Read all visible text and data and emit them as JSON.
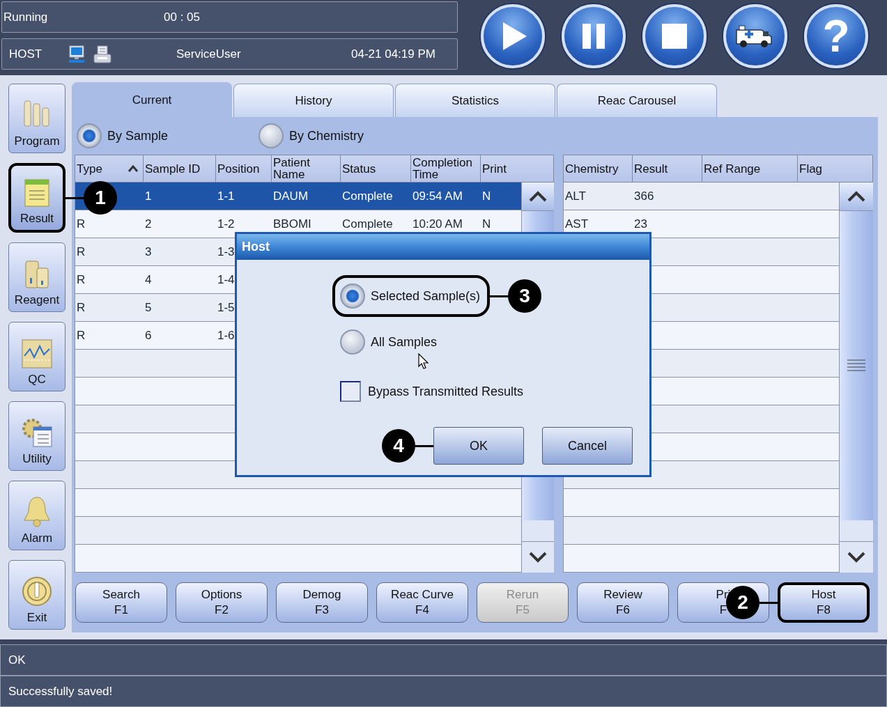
{
  "status_panel": {
    "state": "Running",
    "timer": "00 : 05",
    "mode": "HOST",
    "user": "ServiceUser",
    "datetime": "04-21 04:19 PM"
  },
  "toolbar": [
    {
      "kind": "play"
    },
    {
      "kind": "pause"
    },
    {
      "kind": "stop"
    },
    {
      "kind": "stat"
    },
    {
      "kind": "help",
      "glyph": "?"
    }
  ],
  "sidebar": [
    {
      "label": "Program",
      "kind": "program",
      "selected": false,
      "highlighted": false
    },
    {
      "label": "Result",
      "kind": "result",
      "selected": true,
      "highlighted": true,
      "callout": "1"
    },
    {
      "label": "Reagent",
      "kind": "reagent",
      "selected": false,
      "highlighted": false
    },
    {
      "label": "QC",
      "kind": "qc",
      "selected": false,
      "highlighted": false
    },
    {
      "label": "Utility",
      "kind": "utility",
      "selected": false,
      "highlighted": false
    },
    {
      "label": "Alarm",
      "kind": "alarm",
      "selected": false,
      "highlighted": false
    },
    {
      "label": "Exit",
      "kind": "exit",
      "selected": false,
      "highlighted": false
    }
  ],
  "tabs": [
    {
      "label": "Current",
      "selected": true
    },
    {
      "label": "History",
      "selected": false
    },
    {
      "label": "Statistics",
      "selected": false
    },
    {
      "label": "Reac Carousel",
      "selected": false
    }
  ],
  "view_options": [
    {
      "label": "By Sample",
      "selected": true
    },
    {
      "label": "By Chemistry",
      "selected": false
    }
  ],
  "sample_table": {
    "columns": [
      {
        "label": "Type",
        "sorted": true
      },
      {
        "label": "Sample ID",
        "sorted": false
      },
      {
        "label": "Position",
        "sorted": false
      },
      {
        "label": "Patient Name",
        "sorted": false
      },
      {
        "label": "Status",
        "sorted": false
      },
      {
        "label": "Completion Time",
        "sorted": false
      },
      {
        "label": "Print",
        "sorted": false
      }
    ],
    "rows": [
      {
        "cells": [
          null,
          "1",
          "1-1",
          "DAUM",
          "Complete",
          "09:54 AM",
          "N"
        ],
        "selected": true
      },
      {
        "cells": [
          "R",
          "2",
          "1-2",
          "BBOMI",
          "Complete",
          "10:20 AM",
          "N"
        ],
        "selected": false
      },
      {
        "cells": [
          "R",
          "3",
          "1-3"
        ],
        "selected": false
      },
      {
        "cells": [
          "R",
          "4",
          "1-4"
        ],
        "selected": false
      },
      {
        "cells": [
          "R",
          "5",
          "1-5"
        ],
        "selected": false
      },
      {
        "cells": [
          "R",
          "6",
          "1-6"
        ],
        "selected": false
      }
    ]
  },
  "chemistry_table": {
    "columns": [
      "Chemistry",
      "Result",
      "Ref Range",
      "Flag"
    ],
    "rows": [
      {
        "cells": [
          "ALT",
          "366"
        ]
      },
      {
        "cells": [
          "AST",
          "23"
        ]
      }
    ]
  },
  "function_keys": [
    {
      "label": "Search",
      "key": "F1",
      "disabled": false,
      "highlighted": false
    },
    {
      "label": "Options",
      "key": "F2",
      "disabled": false,
      "highlighted": false
    },
    {
      "label": "Demog",
      "key": "F3",
      "disabled": false,
      "highlighted": false
    },
    {
      "label": "Reac Curve",
      "key": "F4",
      "disabled": false,
      "highlighted": false
    },
    {
      "label": "Rerun",
      "key": "F5",
      "disabled": true,
      "highlighted": false
    },
    {
      "label": "Review",
      "key": "F6",
      "disabled": false,
      "highlighted": false
    },
    {
      "label": "Pri",
      "key": "F",
      "disabled": false,
      "highlighted": false
    },
    {
      "label": "Host",
      "key": "F8",
      "disabled": false,
      "highlighted": true,
      "callout": "2"
    }
  ],
  "messages": [
    "OK",
    "Successfully saved!"
  ],
  "dialog": {
    "title": "Host",
    "options": [
      {
        "label": "Selected Sample(s)",
        "selected": true,
        "highlighted": true,
        "callout": "3"
      },
      {
        "label": "All Samples",
        "selected": false,
        "highlighted": false
      }
    ],
    "checkbox": {
      "label": "Bypass Transmitted Results",
      "checked": false
    },
    "buttons": [
      {
        "label": "OK",
        "callout": "4"
      },
      {
        "label": "Cancel"
      }
    ]
  }
}
